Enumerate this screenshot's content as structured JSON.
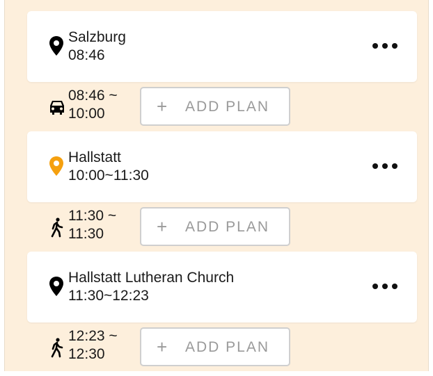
{
  "colors": {
    "panel_bg": "#fdefdc",
    "active_pin": "#f5a00f",
    "pin": "#000000"
  },
  "stops": [
    {
      "name": "Salzburg",
      "time": "08:46",
      "icon": "location-pin-icon",
      "active": false
    },
    {
      "name": "Hallstatt",
      "time": "10:00~11:30",
      "icon": "location-pin-icon",
      "active": true
    },
    {
      "name": "Hallstatt Lutheran Church",
      "time": "11:30~12:23",
      "icon": "location-pin-icon",
      "active": false
    }
  ],
  "transits": [
    {
      "mode_icon": "car-icon",
      "start": "08:46 ~",
      "end": "10:00",
      "add_label": "ADD PLAN",
      "plus": "+"
    },
    {
      "mode_icon": "walking-icon",
      "start": "11:30 ~",
      "end": "11:30",
      "add_label": "ADD PLAN",
      "plus": "+"
    },
    {
      "mode_icon": "walking-icon",
      "start": "12:23 ~",
      "end": "12:30",
      "add_label": "ADD PLAN",
      "plus": "+"
    }
  ]
}
